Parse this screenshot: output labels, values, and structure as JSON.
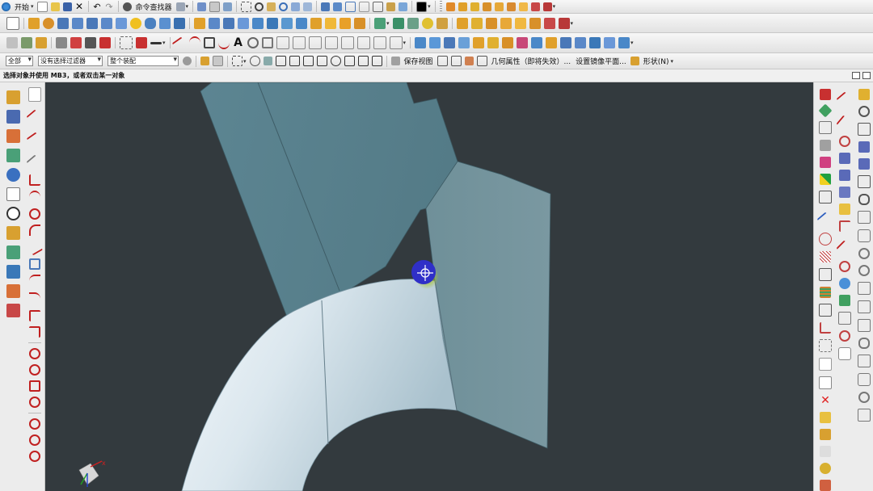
{
  "toolbar1": {
    "start_label": "开始",
    "command_finder_label": "命令查找器"
  },
  "selection_bar": {
    "filter_all": "全部",
    "no_filter": "没有选择过滤器",
    "assembly_scope": "整个装配",
    "save_view": "保存视图",
    "geometry_property": "几何属性（即将失效）...",
    "set_mirror_plane": "设置镜像平面...",
    "shape_menu": "形状(N)"
  },
  "cue_line": "选择对象并使用 MB3，或者双击某一对象",
  "icons": {
    "start": "nx-logo-icon",
    "command_finder": "binoculars-icon",
    "close": "close-icon",
    "undo": "undo-icon",
    "redo": "redo-icon",
    "snap_point": "snap-point-icon",
    "orientation": "wcs-triad-icon"
  },
  "colors": {
    "viewport_bg": "#333a3e",
    "surface_dark": "#5a808c",
    "surface_mid": "#74939c",
    "surface_light": "#dbe6ed",
    "cursor": "#2f2fc8",
    "cursor_glow": "#a8c43a",
    "delete_red": "#e02020"
  }
}
